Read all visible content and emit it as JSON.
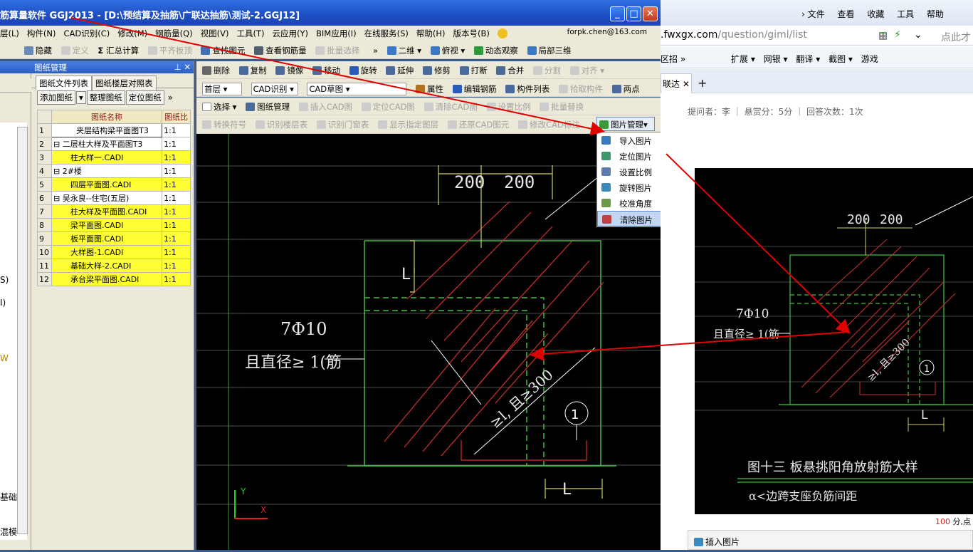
{
  "app": {
    "title": "筋算量软件 GGJ2013 - [D:\\预结算及抽筋\\广联达抽筋\\测试-2.GGJ12]",
    "menu": [
      "层(L)",
      "构件(N)",
      "CAD识别(C)",
      "修改(M)",
      "钢筋量(Q)",
      "视图(V)",
      "工具(T)",
      "云应用(Y)",
      "BIM应用(I)",
      "在线服务(S)",
      "帮助(H)",
      "版本号(B)"
    ],
    "email": "forpk.chen@163.com"
  },
  "toolbar1": {
    "left": [
      "隐藏",
      "定义",
      "汇总计算",
      "平齐板顶",
      "查找图元",
      "查看钢筋量",
      "批量选择"
    ],
    "right": [
      "二维",
      "俯视",
      "动态观察",
      "局部三维"
    ]
  },
  "toolbar2": [
    "删除",
    "复制",
    "镜像",
    "移动",
    "旋转",
    "延伸",
    "修剪",
    "打断",
    "合并",
    "分割",
    "对齐"
  ],
  "toolbar3": {
    "floor": "首层",
    "cad_recog": "CAD识别",
    "cad_draft": "CAD草图",
    "items": [
      "属性",
      "编辑钢筋",
      "构件列表",
      "拾取构件",
      "两点"
    ]
  },
  "toolbar4": [
    "选择",
    "图纸管理",
    "插入CAD图",
    "定位CAD图",
    "清除CAD图",
    "设置比例",
    "批量替换"
  ],
  "toolbar5": [
    "转换符号",
    "识别楼层表",
    "识别门窗表",
    "显示指定图层",
    "还原CAD图元",
    "修改CAD标注"
  ],
  "picture_mgmt": {
    "label": "图片管理",
    "items": [
      "导入图片",
      "定位图片",
      "设置比例",
      "旋转图片",
      "校准角度",
      "清除图片"
    ],
    "selected": "清除图片"
  },
  "panel": {
    "title": "图纸管理",
    "tabs": [
      "图纸文件列表",
      "图纸楼层对照表"
    ],
    "buttons": [
      "添加图纸",
      "整理图纸",
      "定位图纸"
    ],
    "col_name": "图纸名称",
    "col_ratio": "图纸比",
    "rows": [
      {
        "n": "1",
        "name": "夹层结构梁平面图T3",
        "ratio": "1:1",
        "hl": false,
        "grp": false
      },
      {
        "n": "2",
        "name": "二层柱大样及平面图T3",
        "ratio": "1:1",
        "hl": false,
        "grp": true
      },
      {
        "n": "3",
        "name": "柱大样一.CADI",
        "ratio": "1:1",
        "hl": true,
        "grp": false
      },
      {
        "n": "4",
        "name": "2#楼",
        "ratio": "1:1",
        "hl": false,
        "grp": true
      },
      {
        "n": "5",
        "name": "四层平面图.CADI",
        "ratio": "1:1",
        "hl": true,
        "grp": false
      },
      {
        "n": "6",
        "name": "吴永良--住宅(五层)",
        "ratio": "1:1",
        "hl": false,
        "grp": true
      },
      {
        "n": "7",
        "name": "柱大样及平面图.CADI",
        "ratio": "1:1",
        "hl": true,
        "grp": false
      },
      {
        "n": "8",
        "name": "梁平面图.CADI",
        "ratio": "1:1",
        "hl": true,
        "grp": false
      },
      {
        "n": "9",
        "name": "板平面图.CADI",
        "ratio": "1:1",
        "hl": true,
        "grp": false
      },
      {
        "n": "10",
        "name": "大样图-1.CADI",
        "ratio": "1:1",
        "hl": true,
        "grp": false
      },
      {
        "n": "11",
        "name": "基础大样-2.CADI",
        "ratio": "1:1",
        "hl": true,
        "grp": false
      },
      {
        "n": "12",
        "name": "承台梁平面图.CADI",
        "ratio": "1:1",
        "hl": true,
        "grp": false
      }
    ]
  },
  "left_strip": [
    "S)",
    "I)",
    "W",
    "基础",
    "混模"
  ],
  "cad": {
    "dim1": "200",
    "dim2": "200",
    "rebar": "7Φ10",
    "note": "且直径≥ 1(筋",
    "angle": "≥l, 且≥300",
    "circle": "1",
    "L": "L",
    "axis_y": "Y",
    "axis_x": "X"
  },
  "browser": {
    "menu": [
      "文件",
      "查看",
      "收藏",
      "工具",
      "帮助"
    ],
    "url_domain": ".fwxgx.com",
    "url_path": "/question/giml/list",
    "search_hint": "点此才",
    "bookmarks": [
      "扩展",
      "网银",
      "翻译",
      "截图",
      "游戏"
    ],
    "bk_left": "区招",
    "tab_label": "联达",
    "qinfo": {
      "asker": "提问者：李",
      "reward": "悬赏分：5分",
      "answers": "回答次数：1次"
    },
    "photo": {
      "dim1": "200",
      "dim2": "200",
      "rebar": "7Φ10",
      "note": "且直径≥ 1(筋",
      "angle": "≥l, 且≥300",
      "circle": "1",
      "L": "L",
      "caption": "图十三  板悬挑阳角放射筋大样",
      "sub": "α<边跨支座负筋间距"
    },
    "points": "100",
    "points_unit": "分,点",
    "insert": "插入图片"
  }
}
